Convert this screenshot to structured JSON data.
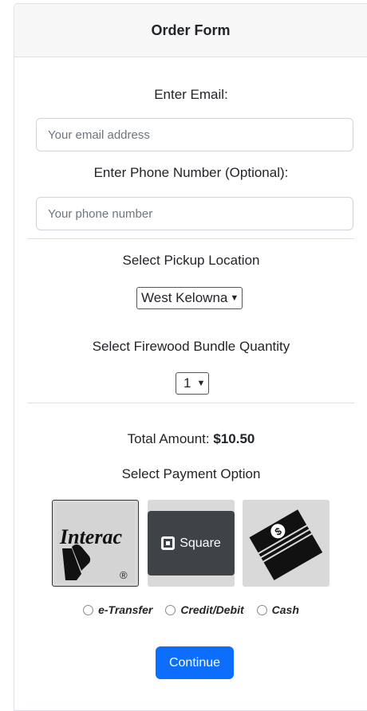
{
  "header": {
    "title": "Order Form"
  },
  "email": {
    "label": "Enter Email:",
    "placeholder": "Your email address",
    "value": ""
  },
  "phone": {
    "label": "Enter Phone Number (Optional):",
    "placeholder": "Your phone number",
    "value": ""
  },
  "pickup": {
    "label": "Select Pickup Location",
    "selected": "West Kelowna"
  },
  "quantity": {
    "label": "Select Firewood Bundle Quantity",
    "selected": "1"
  },
  "total": {
    "label": "Total Amount:",
    "amount": "$10.50"
  },
  "payment": {
    "label": "Select Payment Option",
    "options": [
      {
        "label": "e-Transfer",
        "logo": "Interac",
        "logo_mark": "®",
        "icon": "interac-logo-icon"
      },
      {
        "label": "Credit/Debit",
        "logo": "Square",
        "icon": "square-logo-icon"
      },
      {
        "label": "Cash",
        "icon": "cash-stack-icon"
      }
    ]
  },
  "colors": {
    "primary": "#0d6efd",
    "border": "#dee2e6",
    "tile": "#d9d9d9",
    "square_bg": "#3e4347"
  },
  "continue_button": {
    "label": "Continue"
  }
}
